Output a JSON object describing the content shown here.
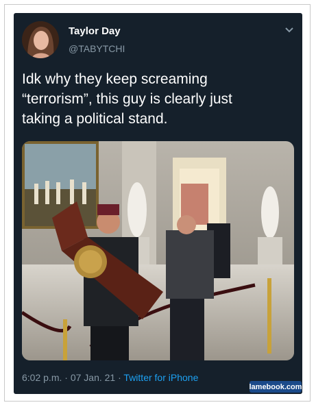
{
  "tweet": {
    "author_name": "Taylor Day",
    "author_handle": "@TABYTCHI",
    "text": "Idk why they keep screaming\n“terrorism”, this guy is clearly just\ntaking a political stand.",
    "time": "6:02 p.m.",
    "separator": " · ",
    "date": "07 Jan. 21",
    "client": "Twitter for iPhone"
  },
  "watermark": {
    "text": "lamebook.com"
  },
  "colors": {
    "card_bg": "#15202b",
    "secondary_text": "#8899a6",
    "link": "#1da1f2"
  },
  "icons": {
    "menu": "chevron-down-icon"
  }
}
